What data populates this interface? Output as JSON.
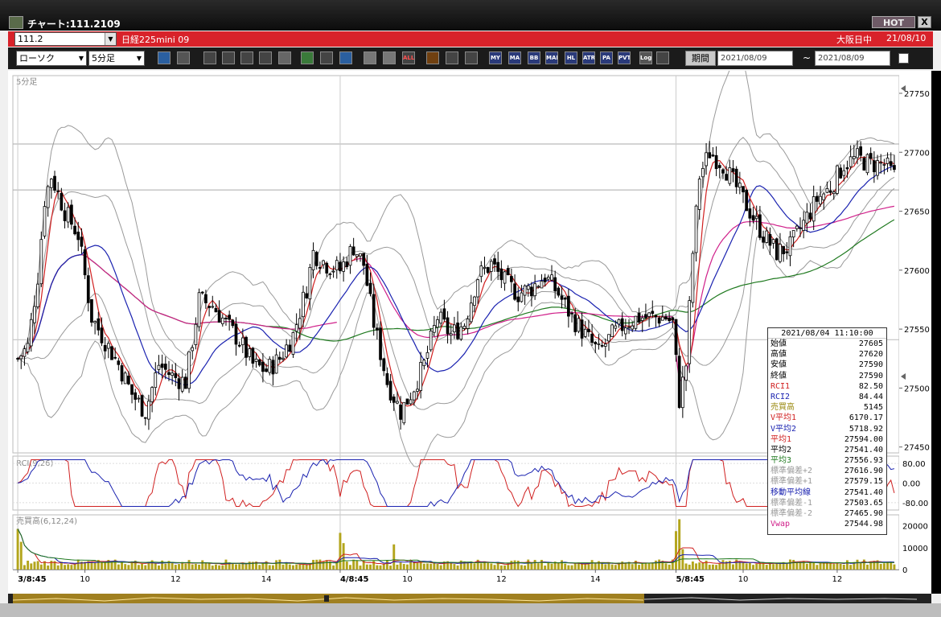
{
  "window": {
    "title": "チャート:111.2109",
    "hot_label": "HOT",
    "close_label": "X"
  },
  "symbol_bar": {
    "code": "111.2",
    "name": "日経225mini 09",
    "session": "大阪日中",
    "date": "21/08/10"
  },
  "toolbar": {
    "chart_type": "ローソク",
    "interval": "5分足",
    "buttons": [
      "zoom-icon",
      "crosshair-icon",
      "download-icon",
      "search-chart-icon",
      "bar-compare-icon",
      "multi-chart-icon",
      "inactive-icon",
      "pencil-icon",
      "cursor-icon",
      "redo-icon",
      "candle-icon",
      "candle-alt-icon",
      "ALL",
      "fibonacci-icon",
      "color-picker-icon",
      "gradient-icon",
      "MY",
      "MA",
      "BB",
      "MAE",
      "HL",
      "ATR",
      "PARA",
      "PVT",
      "Log",
      "snapshot-icon"
    ],
    "button_labels": {
      "ALL": "ALL",
      "MY": "MY",
      "MA": "MA",
      "BB": "BB",
      "MAE": "MAE",
      "HL": "HL",
      "ATR": "ATR",
      "PARA": "PA RA",
      "PVT": "PVT",
      "Log": "Log"
    },
    "period_label": "期間",
    "date_from": "2021/08/09",
    "date_to": "2021/08/09",
    "tilde": "~"
  },
  "chart": {
    "main_label": "5分足",
    "rci_label": "RCI(9,26)",
    "vol_label": "売買高(6,12,24)",
    "colors": {
      "candle": "#000000",
      "bb": "#9a9a9a",
      "rci1": "#d02020",
      "rci2": "#1a22b0",
      "ma1": "#d02020",
      "ma2": "#1a22b0",
      "ma3": "#207a20",
      "vwap": "#d0208a",
      "volume": "#b3a51c",
      "vol_ma1": "#d02020",
      "vol_ma2": "#1a22b0",
      "vol_ma3": "#207a20"
    },
    "price_axis": [
      "27750",
      "27700",
      "27650",
      "27600",
      "27550",
      "27500",
      "27450"
    ],
    "rci_axis": [
      "80.00",
      "0.00",
      "-80.00"
    ],
    "vol_axis": [
      "20000",
      "10000",
      "0"
    ],
    "x_axis": [
      "3/8:45",
      "10",
      "12",
      "14",
      "4/8:45",
      "10",
      "12",
      "14",
      "5/8:45",
      "10",
      "12"
    ],
    "price_range": [
      27445,
      27765
    ],
    "volume_range": [
      0,
      25000
    ],
    "rci_range": [
      -100,
      100
    ]
  },
  "chart_data": {
    "type": "candlestick",
    "interval": "5分足",
    "sessions": [
      "3/8:45",
      "4/8:45",
      "5/8:45"
    ],
    "price_axis_ticks": [
      27750,
      27700,
      27650,
      27600,
      27550,
      27500,
      27450
    ],
    "ylim": [
      27445,
      27765
    ],
    "close_path": [
      [
        0,
        27525
      ],
      [
        3,
        27535
      ],
      [
        6,
        27595
      ],
      [
        8,
        27660
      ],
      [
        10,
        27680
      ],
      [
        14,
        27650
      ],
      [
        18,
        27630
      ],
      [
        22,
        27560
      ],
      [
        26,
        27540
      ],
      [
        30,
        27520
      ],
      [
        34,
        27495
      ],
      [
        38,
        27480
      ],
      [
        42,
        27520
      ],
      [
        46,
        27510
      ],
      [
        50,
        27505
      ],
      [
        54,
        27575
      ],
      [
        58,
        27570
      ],
      [
        62,
        27555
      ],
      [
        66,
        27540
      ],
      [
        70,
        27520
      ],
      [
        74,
        27515
      ],
      [
        78,
        27525
      ],
      [
        82,
        27545
      ],
      [
        86,
        27585
      ],
      [
        88,
        27615
      ],
      [
        92,
        27605
      ],
      [
        96,
        27600
      ],
      [
        100,
        27620
      ],
      [
        103,
        27605
      ],
      [
        106,
        27555
      ],
      [
        110,
        27505
      ],
      [
        114,
        27480
      ],
      [
        117,
        27495
      ],
      [
        121,
        27520
      ],
      [
        125,
        27560
      ],
      [
        129,
        27545
      ],
      [
        133,
        27555
      ],
      [
        137,
        27595
      ],
      [
        141,
        27605
      ],
      [
        145,
        27590
      ],
      [
        149,
        27580
      ],
      [
        153,
        27585
      ],
      [
        157,
        27595
      ],
      [
        161,
        27580
      ],
      [
        165,
        27560
      ],
      [
        169,
        27545
      ],
      [
        173,
        27530
      ],
      [
        177,
        27545
      ],
      [
        181,
        27555
      ],
      [
        185,
        27560
      ],
      [
        189,
        27560
      ],
      [
        193,
        27560
      ],
      [
        195,
        27555
      ],
      [
        197,
        27490
      ],
      [
        199,
        27520
      ],
      [
        201,
        27615
      ],
      [
        203,
        27680
      ],
      [
        206,
        27700
      ],
      [
        210,
        27690
      ],
      [
        214,
        27670
      ],
      [
        218,
        27650
      ],
      [
        222,
        27630
      ],
      [
        226,
        27615
      ],
      [
        230,
        27620
      ],
      [
        234,
        27640
      ],
      [
        238,
        27660
      ],
      [
        242,
        27670
      ],
      [
        246,
        27690
      ],
      [
        250,
        27695
      ],
      [
        254,
        27690
      ],
      [
        258,
        27690
      ],
      [
        261,
        27680
      ]
    ],
    "selected_bar": {
      "datetime": "2021/08/04 11:10:00",
      "rows": [
        {
          "label": "始値",
          "value": "27605"
        },
        {
          "label": "高値",
          "value": "27620"
        },
        {
          "label": "安値",
          "value": "27590"
        },
        {
          "label": "終値",
          "value": "27590"
        },
        {
          "label": "RCI1",
          "value": "82.50"
        },
        {
          "label": "RCI2",
          "value": "84.44"
        },
        {
          "label": "売買高",
          "value": "5145"
        },
        {
          "label": "V平均1",
          "value": "6170.17"
        },
        {
          "label": "V平均2",
          "value": "5718.92"
        },
        {
          "label": "平均1",
          "value": "27594.00"
        },
        {
          "label": "平均2",
          "value": "27541.40"
        },
        {
          "label": "平均3",
          "value": "27556.93"
        },
        {
          "label": "標準偏差+2",
          "value": "27616.90"
        },
        {
          "label": "標準偏差+1",
          "value": "27579.15"
        },
        {
          "label": "移動平均線",
          "value": "27541.40"
        },
        {
          "label": "標準偏差-1",
          "value": "27503.65"
        },
        {
          "label": "標準偏差-2",
          "value": "27465.90"
        },
        {
          "label": "Vwap",
          "value": "27544.98"
        }
      ],
      "row_colors": [
        "#000000",
        "#000000",
        "#000000",
        "#000000",
        "#d02020",
        "#1a22b0",
        "#9a8a10",
        "#d02020",
        "#1a22b0",
        "#d02020",
        "#000000",
        "#207a20",
        "#9a9a9a",
        "#9a9a9a",
        "#1a22b0",
        "#9a9a9a",
        "#9a9a9a",
        "#d0208a"
      ]
    }
  }
}
